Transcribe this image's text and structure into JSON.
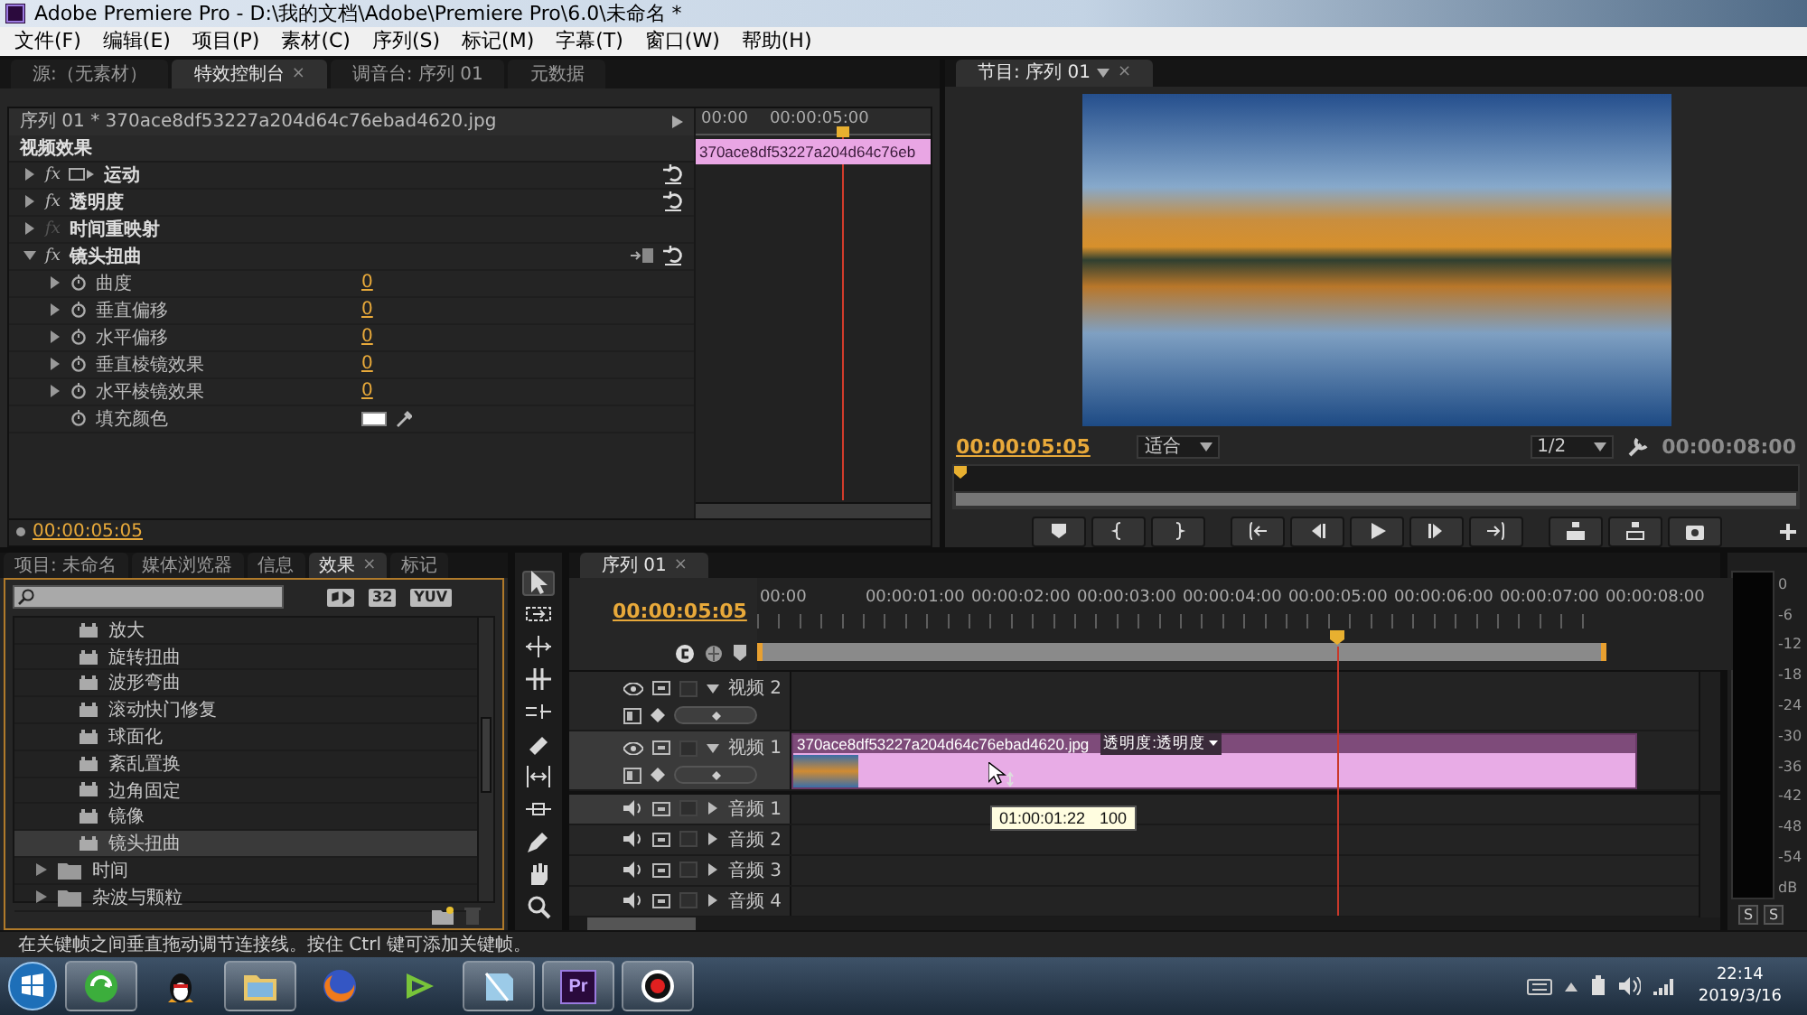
{
  "window": {
    "title": "Adobe Premiere Pro - D:\\我的文档\\Adobe\\Premiere Pro\\6.0\\未命名 *"
  },
  "menu": [
    "文件(F)",
    "编辑(E)",
    "项目(P)",
    "素材(C)",
    "序列(S)",
    "标记(M)",
    "字幕(T)",
    "窗口(W)",
    "帮助(H)"
  ],
  "effect_controls": {
    "tabs": [
      {
        "label": "源:（无素材）",
        "selected": false
      },
      {
        "label": "特效控制台",
        "selected": true
      },
      {
        "label": "调音台: 序列 01",
        "selected": false
      },
      {
        "label": "元数据",
        "selected": false
      }
    ],
    "tab_close": "×",
    "clip_path": "序列 01 * 370ace8df53227a204d64c76ebad4620.jpg",
    "section": "视频效果",
    "ruler": [
      "00:00",
      "00:00:05:00"
    ],
    "clip": "370ace8df53227a204d64c76eb",
    "playhead": {
      "level": 0.645
    },
    "effects": [
      {
        "name": "运动",
        "fx": "fx",
        "kind": "motion",
        "expanded": false,
        "fx_enabled": true,
        "resettable": true
      },
      {
        "name": "透明度",
        "fx": "fx",
        "kind": "standard",
        "expanded": false,
        "fx_enabled": true,
        "resettable": true
      },
      {
        "name": "时间重映射",
        "fx": "fx",
        "kind": "standard",
        "expanded": false,
        "fx_enabled": false,
        "resettable": false
      },
      {
        "name": "镜头扭曲",
        "fx": "fx",
        "kind": "custom",
        "expanded": true,
        "fx_enabled": true,
        "resettable": true
      }
    ],
    "params": [
      {
        "name": "曲度",
        "kind": "number",
        "value": "0",
        "expanded": false
      },
      {
        "name": "垂直偏移",
        "kind": "number",
        "value": "0",
        "expanded": false
      },
      {
        "name": "水平偏移",
        "kind": "number",
        "value": "0",
        "expanded": false
      },
      {
        "name": "垂直棱镜效果",
        "kind": "number",
        "value": "0",
        "expanded": false
      },
      {
        "name": "水平棱镜效果",
        "kind": "number",
        "value": "0",
        "expanded": false
      },
      {
        "name": "填充颜色",
        "kind": "color",
        "color": "#ffffff"
      }
    ],
    "timecode": "00:00:05:05"
  },
  "program": {
    "tab": "节目: 序列 01",
    "tab_close": "×",
    "timecode": "00:00:05:05",
    "zoom": "适合",
    "resolution": "1/2",
    "duration": "00:00:08:00"
  },
  "effects_panel": {
    "tabs": [
      {
        "label": "项目: 未命名",
        "selected": false
      },
      {
        "label": "媒体浏览器",
        "selected": false
      },
      {
        "label": "信息",
        "selected": false
      },
      {
        "label": "效果",
        "selected": true
      },
      {
        "label": "标记",
        "selected": false
      }
    ],
    "tab_close": "×",
    "filters": [
      "32",
      "YUV"
    ],
    "items": [
      {
        "name": "放大",
        "kind": "preset",
        "selected": false
      },
      {
        "name": "旋转扭曲",
        "kind": "preset",
        "selected": false
      },
      {
        "name": "波形弯曲",
        "kind": "preset",
        "selected": false
      },
      {
        "name": "滚动快门修复",
        "kind": "preset",
        "selected": false
      },
      {
        "name": "球面化",
        "kind": "preset",
        "selected": false
      },
      {
        "name": "紊乱置换",
        "kind": "preset",
        "selected": false
      },
      {
        "name": "边角固定",
        "kind": "preset",
        "selected": false
      },
      {
        "name": "镜像",
        "kind": "preset",
        "selected": false
      },
      {
        "name": "镜头扭曲",
        "kind": "preset",
        "selected": true
      },
      {
        "name": "时间",
        "kind": "folder",
        "selected": false
      },
      {
        "name": "杂波与颗粒",
        "kind": "folder",
        "selected": false
      }
    ]
  },
  "tools": [
    {
      "kind": "selection",
      "selected": true
    },
    {
      "kind": "track-select",
      "selected": false
    },
    {
      "kind": "ripple",
      "selected": false
    },
    {
      "kind": "rolling",
      "selected": false
    },
    {
      "kind": "rate",
      "selected": false
    },
    {
      "kind": "razor",
      "selected": false
    },
    {
      "kind": "slip",
      "selected": false
    },
    {
      "kind": "slide",
      "selected": false
    },
    {
      "kind": "pen",
      "selected": false
    },
    {
      "kind": "hand",
      "selected": false
    },
    {
      "kind": "zoom",
      "selected": false
    }
  ],
  "timeline": {
    "tab": "序列 01",
    "tab_close": "×",
    "timecode": "00:00:05:05",
    "ruler": [
      "00:00",
      "00:00:01:00",
      "00:00:02:00",
      "00:00:03:00",
      "00:00:04:00",
      "00:00:05:00",
      "00:00:06:00",
      "00:00:07:00",
      "00:00:08:00"
    ],
    "playhead": {
      "level": 0.645
    },
    "video_tracks": [
      {
        "name": "视频 2",
        "expanded": true,
        "selected": false
      },
      {
        "name": "视频 1",
        "expanded": true,
        "selected": true,
        "clip": {
          "name": "370ace8df53227a204d64c76ebad4620.jpg",
          "effect": "透明度:透明度"
        }
      }
    ],
    "audio_tracks": [
      {
        "name": "音频 1",
        "expanded": false,
        "selected": true
      },
      {
        "name": "音频 2",
        "expanded": false,
        "selected": false
      },
      {
        "name": "音频 3",
        "expanded": false,
        "selected": false
      },
      {
        "name": "音频 4",
        "expanded": false,
        "selected": false
      }
    ],
    "tooltip": {
      "time": "01:00:01:22",
      "value": "100"
    }
  },
  "meter": {
    "scale": [
      "0",
      "-6",
      "-12",
      "-18",
      "-24",
      "-30",
      "-36",
      "-42",
      "-48",
      "-54",
      "dB"
    ],
    "solo": [
      "S",
      "S"
    ]
  },
  "status_bar": "在关键帧之间垂直拖动调节连接线。按住 Ctrl 键可添加关键帧。",
  "taskbar": {
    "apps": [
      {
        "kind": "browser",
        "running": true
      },
      {
        "kind": "penguin",
        "running": false
      },
      {
        "kind": "folder",
        "running": true
      },
      {
        "kind": "fox",
        "running": false
      },
      {
        "kind": "player",
        "running": false
      },
      {
        "kind": "notes",
        "running": true
      },
      {
        "kind": "premiere",
        "label": "Pr",
        "running": true
      },
      {
        "kind": "record",
        "running": true
      }
    ],
    "time": "22:14",
    "date": "2019/3/16"
  }
}
